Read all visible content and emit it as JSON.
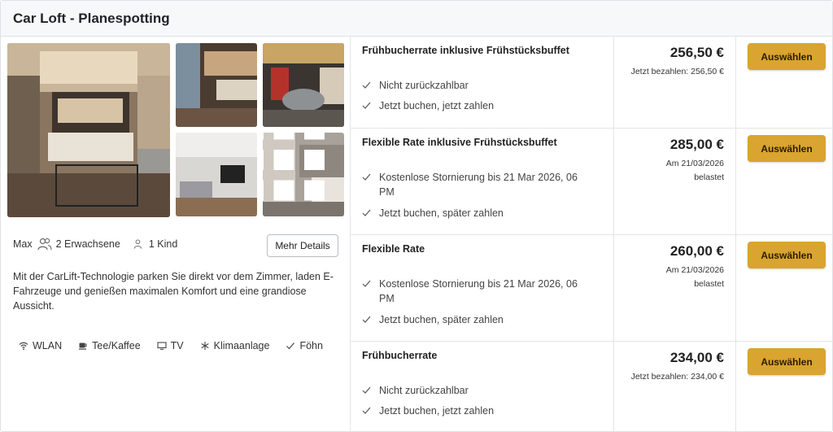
{
  "room": {
    "title": "Car Loft - Planespotting",
    "occupancy": {
      "max_label": "Max",
      "adults": "2 Erwachsene",
      "children": "1 Kind"
    },
    "details_button": "Mehr Details",
    "description": "Mit der CarLift-Technologie parken Sie direkt vor dem Zimmer, laden E-Fahrzeuge und genießen maximalen Komfort und eine grandiose Aussicht.",
    "amenities": [
      {
        "icon": "wifi-icon",
        "label": "WLAN"
      },
      {
        "icon": "coffee-icon",
        "label": "Tee/Kaffee"
      },
      {
        "icon": "tv-icon",
        "label": "TV"
      },
      {
        "icon": "snowflake-icon",
        "label": "Klimaanlage"
      },
      {
        "icon": "check-icon",
        "label": "Föhn"
      }
    ]
  },
  "rates": [
    {
      "name": "Frühbucherrate inklusive Frühstücksbuffet",
      "features": [
        "Nicht zurückzahlbar",
        "Jetzt buchen, jetzt zahlen"
      ],
      "price": "256,50 €",
      "price_note": "Jetzt bezahlen: 256,50 €",
      "button": "Auswählen"
    },
    {
      "name": "Flexible Rate inklusive Frühstücksbuffet",
      "features": [
        "Kostenlose Stornierung bis 21 Mar 2026, 06 PM",
        "Jetzt buchen, später zahlen"
      ],
      "price": "285,00 €",
      "price_note": "Am 21/03/2026 belastet",
      "button": "Auswählen"
    },
    {
      "name": "Flexible Rate",
      "features": [
        "Kostenlose Stornierung bis 21 Mar 2026, 06 PM",
        "Jetzt buchen, später zahlen"
      ],
      "price": "260,00 €",
      "price_note": "Am 21/03/2026 belastet",
      "button": "Auswählen"
    },
    {
      "name": "Frühbucherrate",
      "features": [
        "Nicht zurückzahlbar",
        "Jetzt buchen, jetzt zahlen"
      ],
      "price": "234,00 €",
      "price_note": "Jetzt bezahlen: 234,00 €",
      "button": "Auswählen"
    }
  ],
  "colors": {
    "accent_button": "#d9a430",
    "header_bg": "#f7f8fa",
    "border": "#dfe1e6"
  }
}
